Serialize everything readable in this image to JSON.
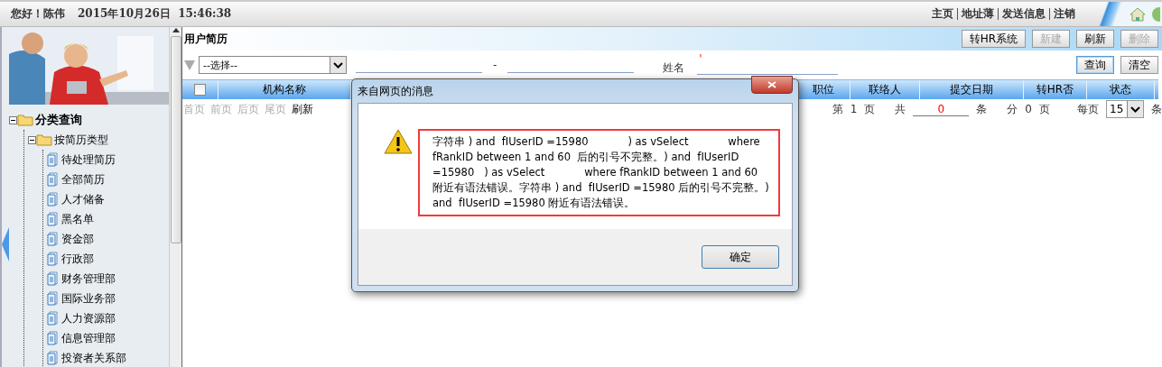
{
  "header": {
    "greeting": "您好！陈伟",
    "datetime": "2015年10月26日  15:46:38",
    "links": [
      "主页",
      "地址薄",
      "发送信息",
      "注销"
    ]
  },
  "sidebar": {
    "tree": [
      {
        "label": "分类查询",
        "expanded": true,
        "children": [
          {
            "label": "按简历类型",
            "expanded": true,
            "children": [
              {
                "label": "待处理简历"
              },
              {
                "label": "全部简历"
              },
              {
                "label": "人才储备"
              },
              {
                "label": "黑名单"
              },
              {
                "label": "资金部"
              },
              {
                "label": "行政部"
              },
              {
                "label": "财务管理部"
              },
              {
                "label": "国际业务部"
              },
              {
                "label": "人力资源部"
              },
              {
                "label": "信息管理部"
              },
              {
                "label": "投资者关系部"
              }
            ]
          }
        ]
      }
    ]
  },
  "panel": {
    "title": "用户简历",
    "toolbar": [
      {
        "label": "转HR系统",
        "disabled": false
      },
      {
        "label": "新建",
        "disabled": true
      },
      {
        "label": "刷新",
        "disabled": false
      },
      {
        "label": "删除",
        "disabled": true
      }
    ]
  },
  "filter": {
    "select": "--选择--",
    "separator": "-",
    "name_label": "姓名",
    "name_value": "'",
    "buttons": [
      {
        "label": "查询",
        "selected": true
      },
      {
        "label": "清空",
        "selected": false
      }
    ]
  },
  "table": {
    "select_all_checked": false,
    "columns": [
      "机构名称",
      "职位",
      "联络人",
      "提交日期",
      "转HR否",
      "状态"
    ]
  },
  "pager": {
    "nav": [
      {
        "label": "首页",
        "disabled": true
      },
      {
        "label": "前页",
        "disabled": true
      },
      {
        "label": "后页",
        "disabled": true
      },
      {
        "label": "尾页",
        "disabled": true
      },
      {
        "label": "刷新",
        "disabled": false
      }
    ],
    "page_prefix": "第",
    "page": "1",
    "page_suffix": "页",
    "total_prefix": "共",
    "total": "0",
    "total_suffix": "条",
    "pages_prefix": "分",
    "pages": "0",
    "pages_suffix": "页",
    "per_page_label": "每页",
    "per_page": "15",
    "per_page_suffix": "条"
  },
  "dialog": {
    "title": "来自网页的消息",
    "highlighted": true,
    "message": [
      "字符串 ) and  fIUserID =15980            ) as vSelect            where",
      "fRankID between 1 and 60  后的引号不完整。) and  fIUserID",
      "=15980   ) as vSelect            where fRankID between 1 and 60",
      "附近有语法错误。字符串 ) and  fIUserID =15980 后的引号不完整。)",
      "and  fIUserID =15980 附近有语法错误。"
    ],
    "ok": "确定"
  }
}
